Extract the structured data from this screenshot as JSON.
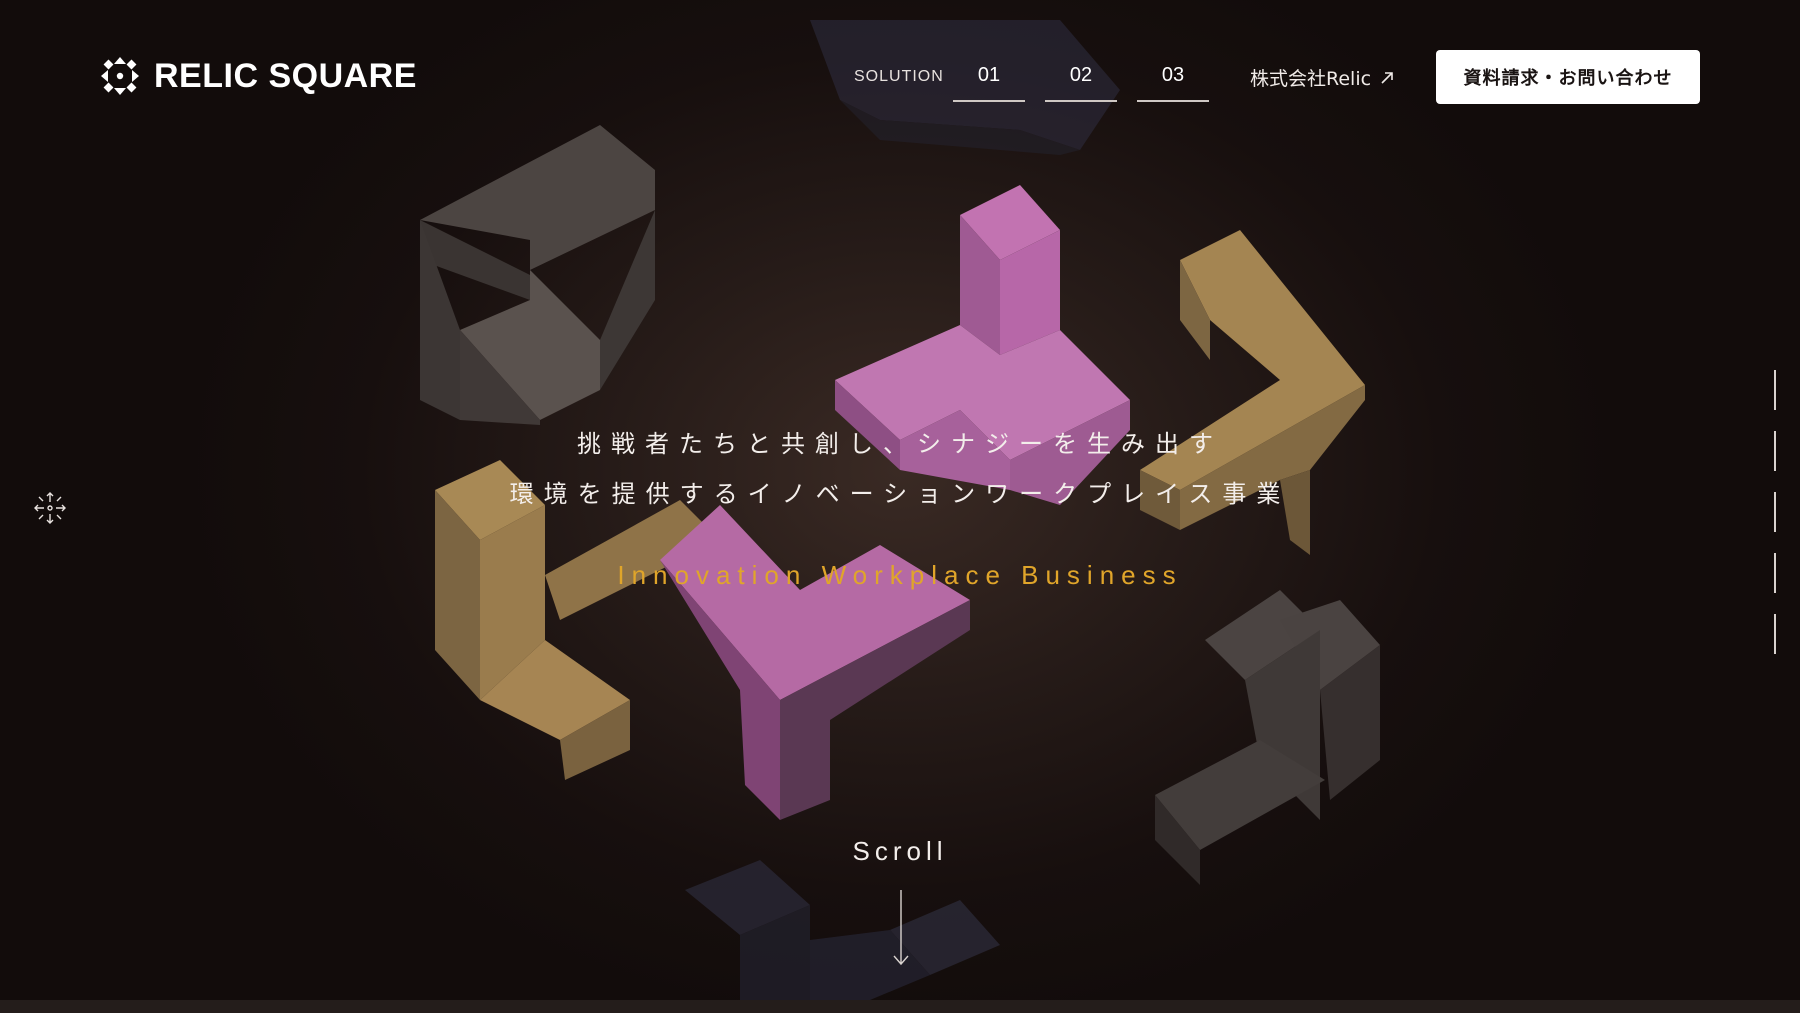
{
  "header": {
    "logo_text": "RELIC SQUARE",
    "nav_label": "SOLUTION",
    "nav_items": [
      "01",
      "02",
      "03"
    ],
    "corporate_link": "株式会社Relic",
    "cta_label": "資料請求・お問い合わせ"
  },
  "hero": {
    "line1": "挑戦者たちと共創し、シナジーを生み出す",
    "line2": "環境を提供するイノベーションワークプレイス事業",
    "subtitle": "Innovation Workplace Business",
    "scroll_label": "Scroll"
  },
  "icons": {
    "logo": "relic-square-logo-mark",
    "side": "relic-mark-icon",
    "corporate_link": "external-link-arrow-icon",
    "scroll": "arrow-down-icon"
  },
  "colors": {
    "background": "#140e0d",
    "accent": "#e0a52a",
    "cta_background": "#ffffff",
    "cta_text": "#1a1413",
    "block_pink": "#b86aa6",
    "block_gold": "#9a7a4c",
    "block_gray": "#4a4341",
    "block_navy": "#2f2e40"
  }
}
